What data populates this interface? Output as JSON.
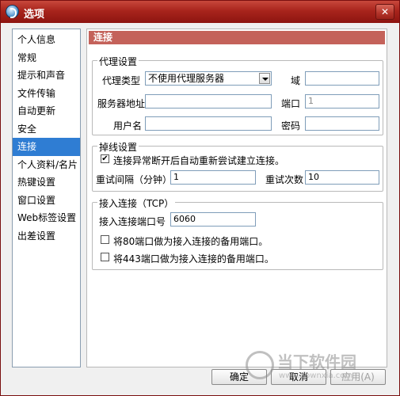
{
  "window": {
    "title": "选项",
    "close_label": "✕"
  },
  "sidebar": {
    "items": [
      {
        "label": "个人信息"
      },
      {
        "label": "常规"
      },
      {
        "label": "提示和声音"
      },
      {
        "label": "文件传输"
      },
      {
        "label": "自动更新"
      },
      {
        "label": "安全"
      },
      {
        "label": "连接",
        "selected": true
      },
      {
        "label": "个人资料/名片"
      },
      {
        "label": "热键设置"
      },
      {
        "label": "窗口设置"
      },
      {
        "label": "Web标签设置"
      },
      {
        "label": "出差设置"
      }
    ]
  },
  "main": {
    "section_title": "连接",
    "proxy": {
      "group_title": "代理设置",
      "type_label": "代理类型",
      "type_value": "不使用代理服务器",
      "domain_label": "域",
      "domain_value": "",
      "server_label": "服务器地址",
      "server_value": "",
      "port_label": "端口",
      "port_value": "1",
      "user_label": "用户名",
      "user_value": "",
      "password_label": "密码",
      "password_value": ""
    },
    "reconnect": {
      "group_title": "掉线设置",
      "auto_label": "连接异常断开后自动重新尝试建立连接。",
      "auto_checked": "✔",
      "interval_label": "重试间隔（分钟）",
      "interval_value": "1",
      "count_label": "重试次数",
      "count_value": "10"
    },
    "incoming": {
      "group_title": "接入连接（TCP）",
      "port_label": "接入连接端口号",
      "port_value": "6060",
      "opt80_label": "将80端口做为接入连接的备用端口。",
      "opt443_label": "将443端口做为接入连接的备用端口。"
    }
  },
  "footer": {
    "ok_label": "确定",
    "cancel_label": "取消",
    "apply_label": "应用(A)"
  },
  "watermark": {
    "line1": "当下软件园",
    "line2": "www.downxia.com"
  }
}
